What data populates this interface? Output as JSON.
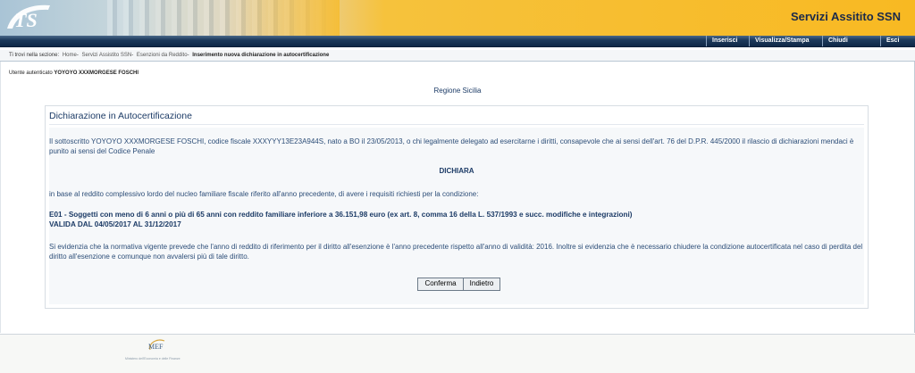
{
  "header": {
    "logo_text": "TS",
    "title": "Servizi Assitito SSN"
  },
  "nav": {
    "items": [
      "Inserisci",
      "Visualizza/Stampa",
      "Chiudi",
      "Esci"
    ]
  },
  "breadcrumb": {
    "label": "Ti trovi nella sezione:",
    "items": [
      "Home",
      "Servizi Assistito SSN",
      "Esenzioni da Reddito"
    ],
    "current": "Inserimento nuova dichiarazione in autocertificazione"
  },
  "user": {
    "label": "Utente autenticato",
    "name": "YOYOYO XXXMORGESE FOSCHI"
  },
  "region": "Regione Sicilia",
  "panel": {
    "title": "Dichiarazione in Autocertificazione",
    "intro": "Il sottoscritto YOYOYO XXXMORGESE FOSCHI, codice fiscale XXXYYY13E23A944S, nato a BO il 23/05/2013, o chi legalmente delegato ad esercitarne i diritti, consapevole che ai sensi dell'art. 76 del D.P.R. 445/2000 il rilascio di dichiarazioni mendaci è punito ai sensi del Codice Penale",
    "declares": "DICHIARA",
    "statement": "in base al reddito complessivo lordo del nucleo familiare fiscale riferito all'anno precedente, di avere i requisiti richiesti per la condizione:",
    "condition": "E01 - Soggetti con meno di 6 anni o più di 65 anni con reddito familiare inferiore a 36.151,98 euro (ex art. 8, comma 16 della L. 537/1993 e succ. modifiche e integrazioni)",
    "validity": "VALIDA DAL 04/05/2017 AL 31/12/2017",
    "note": "Si evidenzia che la normativa vigente prevede che l'anno di reddito di riferimento per il diritto all'esenzione è l'anno precedente rispetto all'anno di validità: 2016. Inoltre si evidenzia che è necessario chiudere la condizione autocertificata nel caso di perdita del diritto all'esenzione e comunque non avvalersi più di tale diritto.",
    "confirm_label": "Conferma",
    "back_label": "Indietro"
  },
  "footer": {
    "logo_text": "MEF",
    "caption": "Ministero dell'Economia e delle Finanze"
  },
  "colors": {
    "header_yellow": "#f8b922",
    "nav_blue": "#1d3a5c",
    "text_blue": "#2d4e78",
    "title_blue": "#1c3b66"
  }
}
